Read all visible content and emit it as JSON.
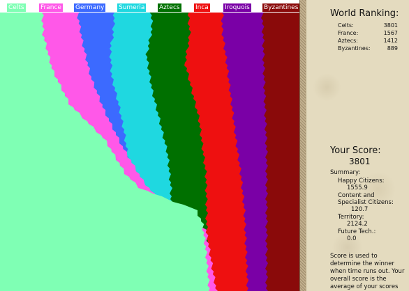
{
  "legend": [
    {
      "label": "Celts",
      "color": "#7fffb4"
    },
    {
      "label": "France",
      "color": "#ff58e8"
    },
    {
      "label": "Germany",
      "color": "#3c6aff"
    },
    {
      "label": "Sumeria",
      "color": "#1fd8e0"
    },
    {
      "label": "Aztecs",
      "color": "#007000"
    },
    {
      "label": "Inca",
      "color": "#ee1010"
    },
    {
      "label": "Iroquois",
      "color": "#7a00a6"
    },
    {
      "label": "Byzantines",
      "color": "#8a0a0a"
    }
  ],
  "ranking": {
    "title": "World Ranking:",
    "rows": [
      {
        "name": "Celts:",
        "value": "3801"
      },
      {
        "name": "France:",
        "value": "1567"
      },
      {
        "name": "Aztecs:",
        "value": "1412"
      },
      {
        "name": "Byzantines:",
        "value": "889"
      }
    ]
  },
  "score": {
    "title": "Your Score:",
    "value": "3801",
    "summary_label": "Summary:",
    "happy_label": "Happy Citizens:",
    "happy_value": "1555.9",
    "content_label_1": "Content and",
    "content_label_2": "Specialist Citizens:",
    "content_value": "120.7",
    "territory_label": "Territory:",
    "territory_value": "2124.2",
    "future_label": "Future Tech.:",
    "future_value": "0.0"
  },
  "note_text": "Score is used to determine the winner when time runs out. Your overall score is the average of your scores"
}
